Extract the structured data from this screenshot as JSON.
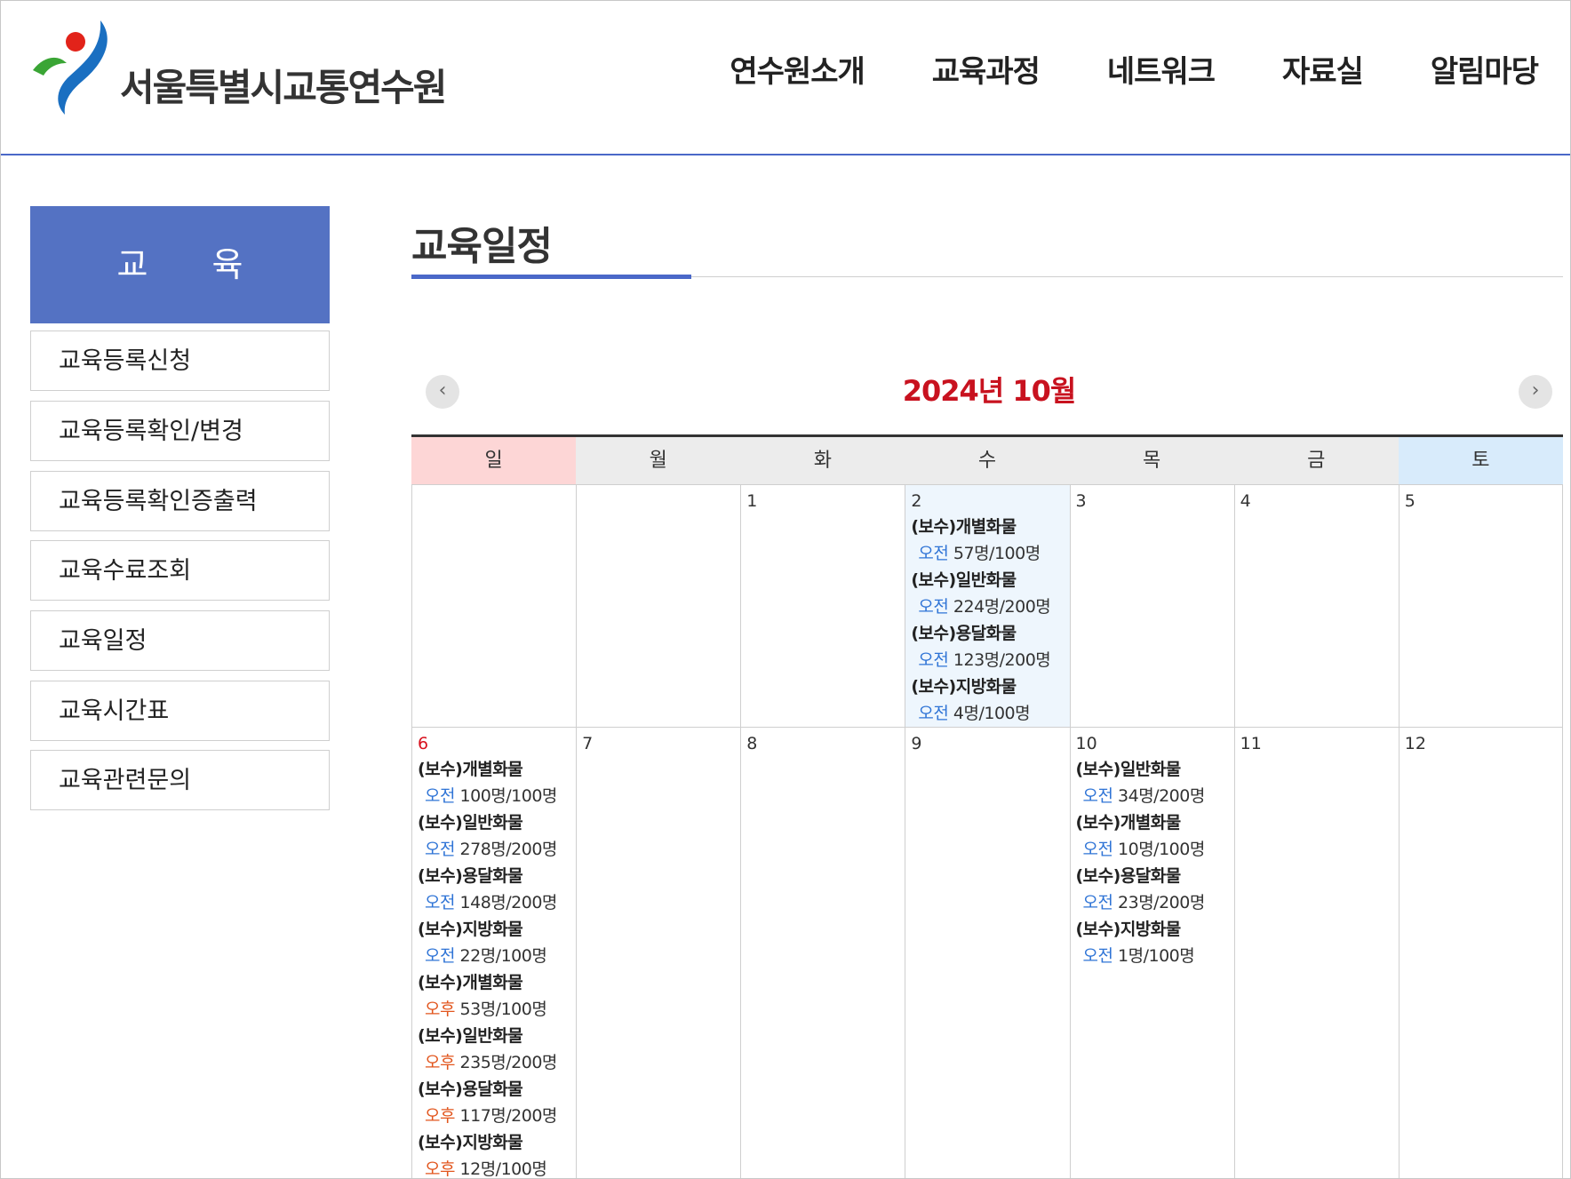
{
  "header": {
    "logo_text": "서울특별시교통연수원",
    "nav": [
      "연수원소개",
      "교육과정",
      "네트워크",
      "자료실",
      "알림마당"
    ]
  },
  "sidebar": {
    "title": "교 육",
    "items": [
      "교육등록신청",
      "교육등록확인/변경",
      "교육등록확인증출력",
      "교육수료조회",
      "교육일정",
      "교육시간표",
      "교육관련문의"
    ]
  },
  "page": {
    "title": "교육일정"
  },
  "calendar": {
    "month_label": "2024년 10월",
    "prev_icon": "‹",
    "next_icon": "›",
    "weekdays": [
      "일",
      "월",
      "화",
      "수",
      "목",
      "금",
      "토"
    ],
    "week1": {
      "days": [
        "",
        "",
        "1",
        "2",
        "3",
        "4",
        "5"
      ],
      "day2_events": [
        {
          "name": "(보수)개별화물",
          "period": "오전",
          "count": "57명/100명"
        },
        {
          "name": "(보수)일반화물",
          "period": "오전",
          "count": "224명/200명"
        },
        {
          "name": "(보수)용달화물",
          "period": "오전",
          "count": "123명/200명"
        },
        {
          "name": "(보수)지방화물",
          "period": "오전",
          "count": "4명/100명"
        }
      ]
    },
    "week2": {
      "days": [
        "6",
        "7",
        "8",
        "9",
        "10",
        "11",
        "12"
      ],
      "day6_events": [
        {
          "name": "(보수)개별화물",
          "period": "오전",
          "count": "100명/100명"
        },
        {
          "name": "(보수)일반화물",
          "period": "오전",
          "count": "278명/200명"
        },
        {
          "name": "(보수)용달화물",
          "period": "오전",
          "count": "148명/200명"
        },
        {
          "name": "(보수)지방화물",
          "period": "오전",
          "count": "22명/100명"
        },
        {
          "name": "(보수)개별화물",
          "period": "오후",
          "count": "53명/100명"
        },
        {
          "name": "(보수)일반화물",
          "period": "오후",
          "count": "235명/200명"
        },
        {
          "name": "(보수)용달화물",
          "period": "오후",
          "count": "117명/200명"
        },
        {
          "name": "(보수)지방화물",
          "period": "오후",
          "count": "12명/100명"
        }
      ],
      "day10_events": [
        {
          "name": "(보수)일반화물",
          "period": "오전",
          "count": "34명/200명"
        },
        {
          "name": "(보수)개별화물",
          "period": "오전",
          "count": "10명/100명"
        },
        {
          "name": "(보수)용달화물",
          "period": "오전",
          "count": "23명/200명"
        },
        {
          "name": "(보수)지방화물",
          "period": "오전",
          "count": "1명/100명"
        }
      ]
    }
  },
  "colors": {
    "accent": "#4a68c8",
    "sidebar_title_bg": "#5472c3",
    "month_label": "#c8121f",
    "sunday_header": "#fdd6d6",
    "saturday_header": "#d8ebfb",
    "am": "#2f74d6",
    "pm": "#e2561e"
  }
}
